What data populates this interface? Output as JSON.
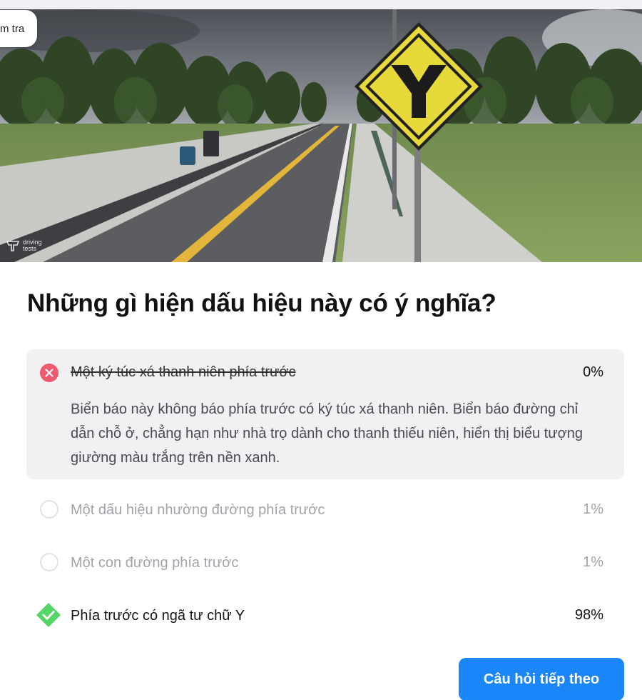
{
  "header": {
    "back_label": "m tra"
  },
  "hero": {
    "watermark": [
      "driving",
      "tests"
    ]
  },
  "question": {
    "text": "Những gì hiện dấu hiệu này có ý nghĩa?"
  },
  "answers": [
    {
      "label": "Một ký túc xá thanh niên phía trước",
      "percent": "0%",
      "state": "wrong",
      "explanation": "Biển báo này không báo phía trước có ký túc xá thanh niên. Biển báo đường chỉ dẫn chỗ ở, chẳng hạn như nhà trọ dành cho thanh thiếu niên, hiển thị biểu tượng giường màu trắng trên nền xanh."
    },
    {
      "label": "Một dấu hiệu nhường đường phía trước",
      "percent": "1%",
      "state": "neutral"
    },
    {
      "label": "Một con đường phía trước",
      "percent": "1%",
      "state": "neutral"
    },
    {
      "label": "Phía trước có ngã tư chữ Y",
      "percent": "98%",
      "state": "correct"
    }
  ],
  "footer": {
    "next_label": "Câu hỏi tiếp theo"
  },
  "colors": {
    "wrong": "#ef5a6f",
    "correct": "#55d467",
    "primary": "#1a86f7",
    "sign": "#e8d93a"
  }
}
